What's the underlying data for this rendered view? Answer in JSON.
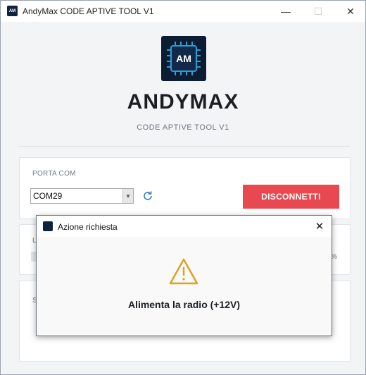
{
  "window": {
    "title": "AndyMax CODE APTIVE TOOL V1",
    "icon_text": "AM"
  },
  "header": {
    "logo_text": "AM",
    "brand": "ANDYMAX",
    "subtitle": "CODE APTIVE TOOL  V1"
  },
  "connection": {
    "label": "PORTA COM",
    "selected_port": "COM29",
    "disconnect_label": "DISCONNETTI"
  },
  "card2": {
    "partial_label": "L",
    "partial_pct": "%"
  },
  "card3": {
    "partial_label": "S"
  },
  "dialog": {
    "title": "Azione richiesta",
    "message": "Alimenta la radio (+12V)"
  },
  "colors": {
    "accent_red": "#e84850",
    "warning": "#e0a020",
    "logo_bg": "#0c1c33"
  }
}
